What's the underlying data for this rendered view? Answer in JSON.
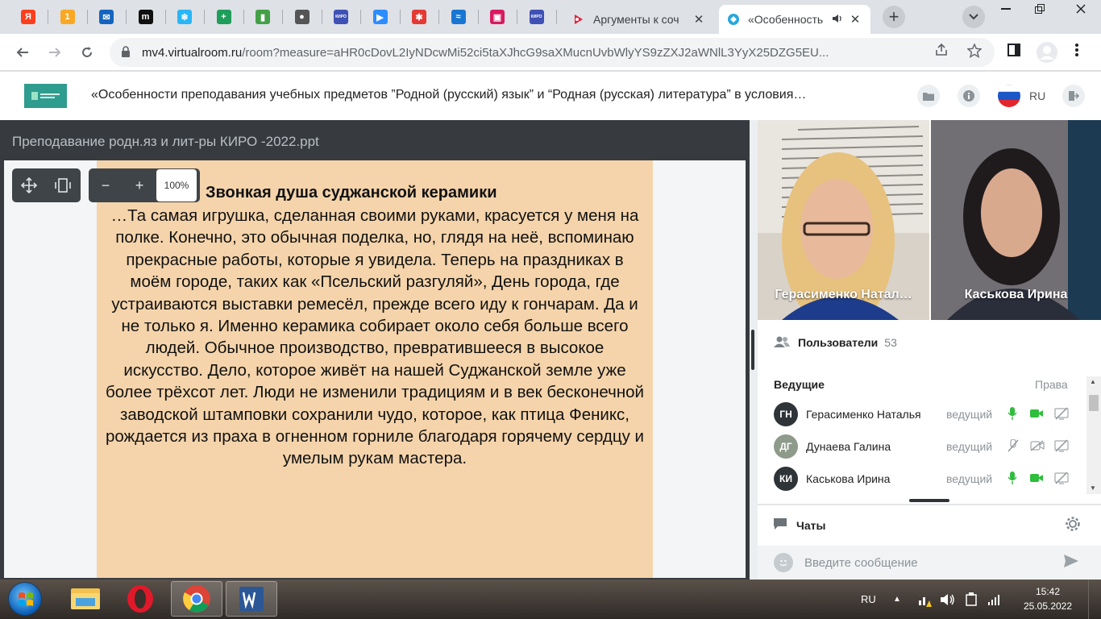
{
  "browser": {
    "pinned_tabs": [
      {
        "icon": "yandex-icon",
        "glyph": "Я",
        "color": "#fc3f1d"
      },
      {
        "icon": "mail-notification-icon",
        "glyph": "1",
        "color": "#f9a825"
      },
      {
        "icon": "mail-icon",
        "glyph": "✉",
        "color": "#1565c0"
      },
      {
        "icon": "m-icon",
        "glyph": "m",
        "color": "#111111"
      },
      {
        "icon": "snowflake-icon",
        "glyph": "❄",
        "color": "#29b6f6"
      },
      {
        "icon": "plus-app-icon",
        "glyph": "+",
        "color": "#1e9e5a"
      },
      {
        "icon": "book-icon",
        "glyph": "▮",
        "color": "#43a047"
      },
      {
        "icon": "globe-icon",
        "glyph": "●",
        "color": "#555555"
      },
      {
        "icon": "kiro-icon",
        "glyph": "КИРО",
        "color": "#3f51b5"
      },
      {
        "icon": "zoom-icon",
        "glyph": "▶",
        "color": "#2d8cff"
      },
      {
        "icon": "dots-app-icon",
        "glyph": "✱",
        "color": "#e53935"
      },
      {
        "icon": "wave-icon",
        "glyph": "≈",
        "color": "#1976d2"
      },
      {
        "icon": "picture-icon",
        "glyph": "▣",
        "color": "#d81b60"
      },
      {
        "icon": "kiro-icon-2",
        "glyph": "КИРО",
        "color": "#3f51b5"
      }
    ],
    "tabs": [
      {
        "title": "Аргументы к соч",
        "close": "✕",
        "active": false
      },
      {
        "title": "«Особенность",
        "close": "✕",
        "active": true
      }
    ],
    "new_tab": "+",
    "address": {
      "host": "mv4.virtualroom.ru",
      "path": "/room?measure=aHR0cDovL2IyNDcwMi52ci5taXJhcG9saXMucnUvbWlyYS9zZXJ2aWNlL3YyX25DZG5EU..."
    }
  },
  "room": {
    "title": "«Особенности преподавания учебных предметов ”Родной (русский) язык” и “Родная (русская) литература” в условия…",
    "language": "RU"
  },
  "presentation": {
    "file_name": "Преподавание родн.яз и лит-ры КИРО -2022.ppt",
    "zoom": "100%",
    "zoom_out": "−",
    "zoom_in": "+",
    "slide_title": "Звонкая душа суджанской керамики",
    "slide_text": "…Та самая игрушка, сделанная своими руками, красуется у меня на полке. Конечно, это обычная поделка, но, глядя на неё, вспоминаю прекрасные работы, которые я увидела. Теперь на праздниках в моём городе, таких как «Псельский разгуляй», День города, где устраиваются выставки ремесёл, прежде всего иду к гончарам. Да и не только я. Именно керамика собирает около себя больше всего людей. Обычное производство, превратившееся в высокое искусство. Дело, которое живёт на нашей Суджанской земле уже более трёхсот лет. Люди не изменили традициям и в век бесконечной заводской штамповки сохранили чудо, которое, как птица Феникс, рождается из праха в огненном горниле благодаря горячему сердцу и умелым рукам мастера."
  },
  "videos": [
    {
      "name": "Герасименко Натал…"
    },
    {
      "name": "Каськова Ирина"
    }
  ],
  "users": {
    "label": "Пользователи",
    "count": "53",
    "presenters_label": "Ведущие",
    "rights_label": "Права",
    "list": [
      {
        "initials": "ГН",
        "name": "Герасименко Наталья",
        "role": "ведущий",
        "avatar_color": "#2f3438",
        "mic": "on",
        "cam": "on"
      },
      {
        "initials": "ДГ",
        "name": "Дунаева Галина",
        "role": "ведущий",
        "avatar_color": "#8e9a8a",
        "mic": "off",
        "cam": "off"
      },
      {
        "initials": "КИ",
        "name": "Каськова Ирина",
        "role": "ведущий",
        "avatar_color": "#2f3438",
        "mic": "on",
        "cam": "on"
      }
    ]
  },
  "chat": {
    "label": "Чаты",
    "placeholder": "Введите сообщение"
  },
  "taskbar": {
    "language": "RU",
    "time": "15:42",
    "date": "25.05.2022"
  }
}
